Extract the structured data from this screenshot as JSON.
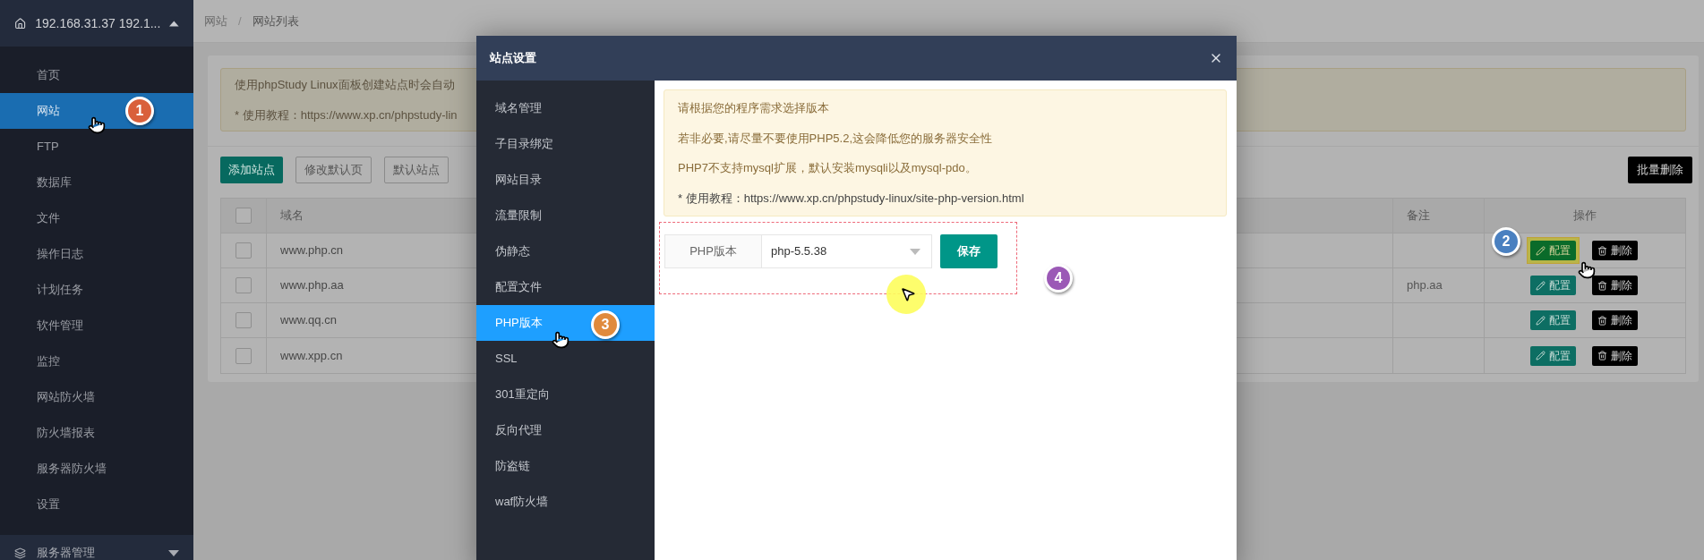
{
  "sidebar": {
    "header": "192.168.31.37 192.1...",
    "items": [
      {
        "label": "首页",
        "selected": false
      },
      {
        "label": "网站",
        "selected": true
      },
      {
        "label": "FTP",
        "selected": false
      },
      {
        "label": "数据库",
        "selected": false
      },
      {
        "label": "文件",
        "selected": false
      },
      {
        "label": "操作日志",
        "selected": false
      },
      {
        "label": "计划任务",
        "selected": false
      },
      {
        "label": "软件管理",
        "selected": false
      },
      {
        "label": "监控",
        "selected": false
      },
      {
        "label": "网站防火墙",
        "selected": false
      },
      {
        "label": "防火墙报表",
        "selected": false
      },
      {
        "label": "服务器防火墙",
        "selected": false
      },
      {
        "label": "设置",
        "selected": false
      }
    ],
    "section": "服务器管理"
  },
  "breadcrumb": [
    "网站",
    "/",
    "网站列表"
  ],
  "notice": [
    "使用phpStudy Linux面板创建站点时会自动",
    "* 使用教程：https://www.xp.cn/phpstudy-lin"
  ],
  "toolbar": [
    {
      "label": "添加站点",
      "kind": "primary"
    },
    {
      "label": "修改默认页",
      "kind": "outline"
    },
    {
      "label": "默认站点",
      "kind": "outline"
    }
  ],
  "batch_delete": "批量删除",
  "table": {
    "header_checked": false,
    "columns": [
      "域名",
      "备注",
      "操作"
    ],
    "rows": [
      {
        "checked": false,
        "domain": "www.php.cn",
        "remark": "",
        "highlighted": true,
        "actions": [
          "配置",
          "删除"
        ]
      },
      {
        "checked": false,
        "domain": "www.php.aa",
        "remark": "php.aa",
        "highlighted": false,
        "actions": [
          "配置",
          "删除"
        ]
      },
      {
        "checked": false,
        "domain": "www.qq.cn",
        "remark": "",
        "highlighted": false,
        "actions": [
          "配置",
          "删除"
        ]
      },
      {
        "checked": false,
        "domain": "www.xpp.cn",
        "remark": "",
        "highlighted": false,
        "actions": [
          "配置",
          "删除"
        ]
      }
    ]
  },
  "modal": {
    "title": "站点设置",
    "nav": [
      {
        "label": "域名管理",
        "selected": false
      },
      {
        "label": "子目录绑定",
        "selected": false
      },
      {
        "label": "网站目录",
        "selected": false
      },
      {
        "label": "流量限制",
        "selected": false
      },
      {
        "label": "伪静态",
        "selected": false
      },
      {
        "label": "配置文件",
        "selected": false
      },
      {
        "label": "PHP版本",
        "selected": true
      },
      {
        "label": "SSL",
        "selected": false
      },
      {
        "label": "301重定向",
        "selected": false
      },
      {
        "label": "反向代理",
        "selected": false
      },
      {
        "label": "防盗链",
        "selected": false
      },
      {
        "label": "waf防火墙",
        "selected": false
      }
    ],
    "notice": [
      "请根据您的程序需求选择版本",
      "若非必要,请尽量不要使用PHP5.2,这会降低您的服务器安全性",
      "PHP7不支持mysql扩展，默认安装mysqli以及mysql-pdo。",
      "* 使用教程：https://www.xp.cn/phpstudy-linux/site-php-version.html"
    ],
    "php_label": "PHP版本",
    "php_version": "php-5.5.38",
    "save": "保存"
  },
  "callouts": [
    {
      "number": "1",
      "color": "#d9603b"
    },
    {
      "number": "2",
      "color": "#4a80c0"
    },
    {
      "number": "3",
      "color": "#e08a3c"
    },
    {
      "number": "4",
      "color": "#9b59b6"
    }
  ]
}
